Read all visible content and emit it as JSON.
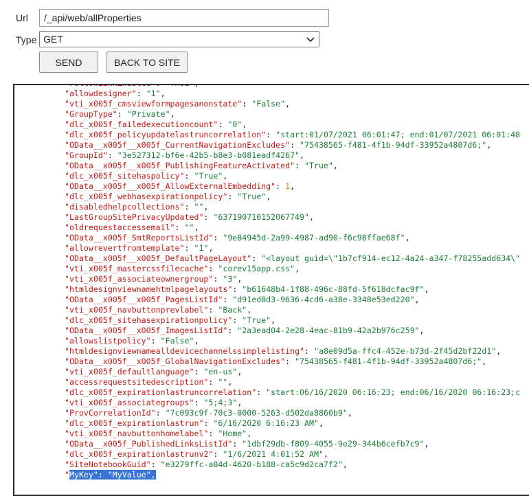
{
  "form": {
    "url_label": "Url",
    "url_value": "/_api/web/allProperties",
    "type_label": "Type",
    "type_value": "GET",
    "send_label": "SEND",
    "back_label": "BACK TO SITE"
  },
  "output": {
    "lines": [
      {
        "key": "\"FollowLinkEnabled\"",
        "sep": ": ",
        "val": "\"TRUE\"",
        "vtype": "s",
        "end": ","
      },
      {
        "key": "\"allowdesigner\"",
        "sep": ": ",
        "val": "\"1\"",
        "vtype": "s",
        "end": ","
      },
      {
        "key": "\"vti_x005f_cmsviewformpagesanonstate\"",
        "sep": ": ",
        "val": "\"False\"",
        "vtype": "s",
        "end": ","
      },
      {
        "key": "\"GroupType\"",
        "sep": ": ",
        "val": "\"Private\"",
        "vtype": "s",
        "end": ","
      },
      {
        "key": "\"dlc_x005f_failedexecutioncount\"",
        "sep": ": ",
        "val": "\"0\"",
        "vtype": "s",
        "end": ","
      },
      {
        "key": "\"dlc_x005f_policyupdatelastruncorrelation\"",
        "sep": ": ",
        "val": "\"start:01/07/2021 06:01:47; end:01/07/2021 06:01:48",
        "vtype": "s",
        "end": ""
      },
      {
        "key": "\"OData__x005f__x005f_CurrentNavigationExcludes\"",
        "sep": ": ",
        "val": "\"75438565-f481-4f1b-94df-33952a4807d6;\"",
        "vtype": "s",
        "end": ","
      },
      {
        "key": "\"GroupId\"",
        "sep": ": ",
        "val": "\"3e527312-bf6e-42b5-b8e3-b081eadf4267\"",
        "vtype": "s",
        "end": ","
      },
      {
        "key": "\"OData__x005f__x005f_PublishingFeatureActivated\"",
        "sep": ": ",
        "val": "\"True\"",
        "vtype": "s",
        "end": ","
      },
      {
        "key": "\"dlc_x005f_sitehaspolicy\"",
        "sep": ": ",
        "val": "\"True\"",
        "vtype": "s",
        "end": ","
      },
      {
        "key": "\"OData__x005f__x005f_AllowExternalEmbedding\"",
        "sep": ": ",
        "val": "1",
        "vtype": "n",
        "end": ","
      },
      {
        "key": "\"dlc_x005f_webhasexpirationpolicy\"",
        "sep": ": ",
        "val": "\"True\"",
        "vtype": "s",
        "end": ","
      },
      {
        "key": "\"disabledhelpcollections\"",
        "sep": ": ",
        "val": "\"\"",
        "vtype": "s",
        "end": ","
      },
      {
        "key": "\"LastGroupSitePrivacyUpdated\"",
        "sep": ": ",
        "val": "\"637190710152067749\"",
        "vtype": "s",
        "end": ","
      },
      {
        "key": "\"oldrequestaccessemail\"",
        "sep": ": ",
        "val": "\"\"",
        "vtype": "s",
        "end": ","
      },
      {
        "key": "\"OData__x005f_SmtReportsListId\"",
        "sep": ": ",
        "val": "\"9e84945d-2a99-4987-ad90-f6c98ffae68f\"",
        "vtype": "s",
        "end": ","
      },
      {
        "key": "\"allowrevertfromtemplate\"",
        "sep": ": ",
        "val": "\"1\"",
        "vtype": "s",
        "end": ","
      },
      {
        "key": "\"OData__x005f__x005f_DefaultPageLayout\"",
        "sep": ": ",
        "val": "\"<layout guid=\\\"1b7cf914-ec12-4a24-a347-f78255add634\\\"",
        "vtype": "s",
        "end": ""
      },
      {
        "key": "\"vti_x005f_mastercssfilecache\"",
        "sep": ": ",
        "val": "\"corev15app.css\"",
        "vtype": "s",
        "end": ","
      },
      {
        "key": "\"vti_x005f_associateownergroup\"",
        "sep": ": ",
        "val": "\"3\"",
        "vtype": "s",
        "end": ","
      },
      {
        "key": "\"htmldesignviewnamehtmlpagelayouts\"",
        "sep": ": ",
        "val": "\"b61648b4-1f88-496c-88fd-5f618dcfac9f\"",
        "vtype": "s",
        "end": ","
      },
      {
        "key": "\"OData__x005f__x005f_PagesListId\"",
        "sep": ": ",
        "val": "\"d91ed8d3-9636-4cd6-a38e-3348e53ed220\"",
        "vtype": "s",
        "end": ","
      },
      {
        "key": "\"vti_x005f_navbuttonprevlabel\"",
        "sep": ": ",
        "val": "\"Back\"",
        "vtype": "s",
        "end": ","
      },
      {
        "key": "\"dlc_x005f_sitehasexpirationpolicy\"",
        "sep": ": ",
        "val": "\"True\"",
        "vtype": "s",
        "end": ","
      },
      {
        "key": "\"OData__x005f__x005f_ImagesListId\"",
        "sep": ": ",
        "val": "\"2a3ead04-2e28-4eac-81b9-42a2b976c259\"",
        "vtype": "s",
        "end": ","
      },
      {
        "key": "\"allowslistpolicy\"",
        "sep": ": ",
        "val": "\"False\"",
        "vtype": "s",
        "end": ","
      },
      {
        "key": "\"htmldesignviewnamealldevicechannelssimplelisting\"",
        "sep": ": ",
        "val": "\"a8e09d5a-ffc4-452e-b73d-2f45d2bf22d1\"",
        "vtype": "s",
        "end": ","
      },
      {
        "key": "\"OData__x005f__x005f_GlobalNavigationExcludes\"",
        "sep": ": ",
        "val": "\"75438565-f481-4f1b-94df-33952a4807d6;\"",
        "vtype": "s",
        "end": ","
      },
      {
        "key": "\"vti_x005f_defaultlanguage\"",
        "sep": ": ",
        "val": "\"en-us\"",
        "vtype": "s",
        "end": ","
      },
      {
        "key": "\"accessrequestsitedescription\"",
        "sep": ": ",
        "val": "\"\"",
        "vtype": "s",
        "end": ","
      },
      {
        "key": "\"dlc_x005f_expirationlastruncorrelation\"",
        "sep": ": ",
        "val": "\"start:06/16/2020 06:16:23; end:06/16/2020 06:16:23;c",
        "vtype": "s",
        "end": ""
      },
      {
        "key": "\"vti_x005f_associategroups\"",
        "sep": ": ",
        "val": "\"5;4;3\"",
        "vtype": "s",
        "end": ","
      },
      {
        "key": "\"ProvCorrelationId\"",
        "sep": ": ",
        "val": "\"7c093c9f-70c3-0000-5263-d502da8860b9\"",
        "vtype": "s",
        "end": ","
      },
      {
        "key": "\"dlc_x005f_expirationlastrun\"",
        "sep": ": ",
        "val": "\"6/16/2020 6:16:23 AM\"",
        "vtype": "s",
        "end": ","
      },
      {
        "key": "\"vti_x005f_navbuttonhomelabel\"",
        "sep": ": ",
        "val": "\"Home\"",
        "vtype": "s",
        "end": ","
      },
      {
        "key": "\"OData__x005f_PublishedLinksListId\"",
        "sep": ": ",
        "val": "\"1dbf29db-f809-4055-9e29-344b6cefb7c9\"",
        "vtype": "s",
        "end": ","
      },
      {
        "key": "\"dlc_x005f_expirationlastrunv2\"",
        "sep": ": ",
        "val": "\"1/6/2021 4:01:52 AM\"",
        "vtype": "s",
        "end": ","
      },
      {
        "key": "\"SiteNotebookGuid\"",
        "sep": ": ",
        "val": "\"e3279ffc-a84d-4620-b188-ca5c9d2ca7f2\"",
        "vtype": "s",
        "end": ","
      },
      {
        "key": "\"MyKey\"",
        "sep": ": ",
        "val": "\"MyValue\"",
        "vtype": "s",
        "end": ",",
        "selected": true
      }
    ]
  },
  "colors": {
    "key": "#c41a16",
    "string": "#1a7f37",
    "number": "#d08a00",
    "selection": "#3875d7"
  },
  "icons": {
    "select_arrow": "chevron-down-icon"
  }
}
